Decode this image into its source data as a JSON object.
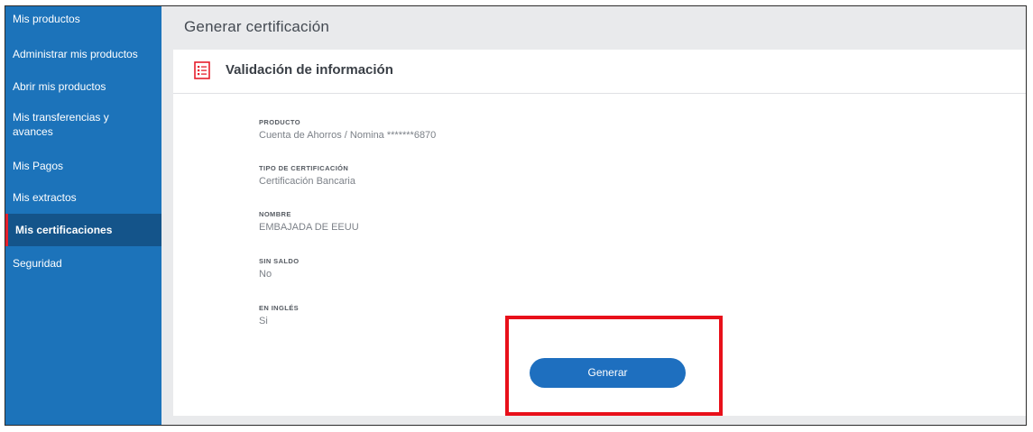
{
  "sidebar": {
    "items": [
      {
        "label": "Mis productos"
      },
      {
        "label": "Administrar mis productos"
      },
      {
        "label": "Abrir mis productos"
      },
      {
        "label": "Mis transferencias y avances"
      },
      {
        "label": "Mis Pagos"
      },
      {
        "label": "Mis extractos"
      },
      {
        "label": "Mis certificaciones",
        "active": true
      },
      {
        "label": "Seguridad"
      }
    ]
  },
  "main": {
    "title": "Generar certificación",
    "section": {
      "icon": "document-list-icon",
      "title": "Validación de información"
    },
    "fields": [
      {
        "label": "PRODUCTO",
        "value": "Cuenta de Ahorros / Nomina *******6870"
      },
      {
        "label": "TIPO DE CERTIFICACIÓN",
        "value": "Certificación Bancaria"
      },
      {
        "label": "NOMBRE",
        "value": "EMBAJADA DE EEUU"
      },
      {
        "label": "SIN SALDO",
        "value": "No"
      },
      {
        "label": "EN INGLÉS",
        "value": "Si"
      }
    ],
    "generate_label": "Generar"
  },
  "colors": {
    "sidebar": "#1c73ba",
    "sidebar_active": "#14548a",
    "accent_red": "#e61e2c",
    "button": "#1e6fbf",
    "highlight": "#e8101a"
  }
}
